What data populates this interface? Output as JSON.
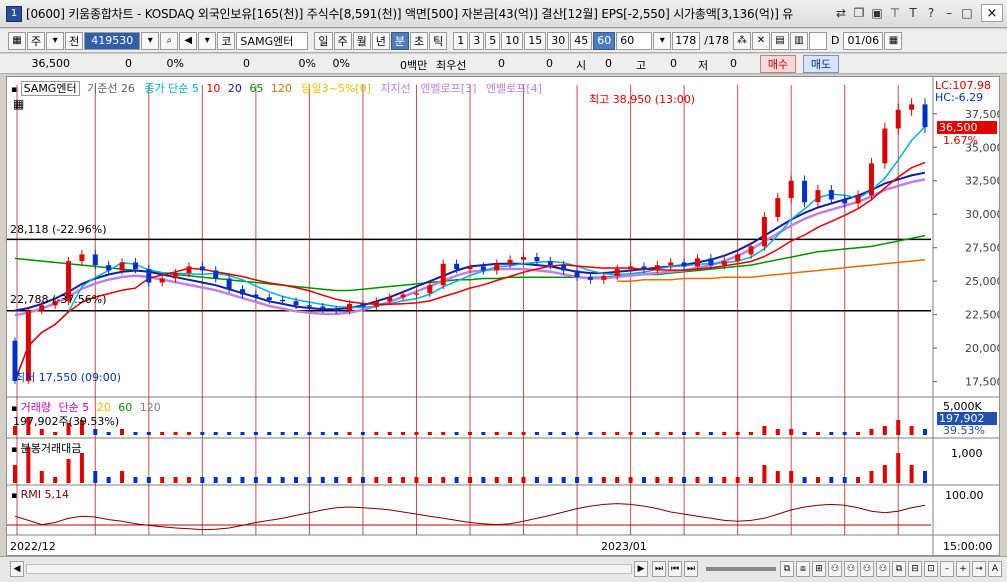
{
  "window": {
    "number": "1",
    "title": "[0600] 키움종합차트 - KOSDAQ 외국인보유[165(천)] 주식수[8,591(천)] 액면[500] 자본금[43(억)] 결산[12월] EPS[-2,550] 시가총액[3,136(억)] 유",
    "icons": [
      "link-icon",
      "copy-icon",
      "restore-icon",
      "pin-icon",
      "font-icon",
      "help-icon",
      "minimize-icon",
      "maximize-icon"
    ],
    "close_label": "×"
  },
  "toolbar": {
    "code_btn": "주",
    "prev_btn": "전",
    "code_value": "419530",
    "market_btn": "코",
    "stock_name": "SAMG엔터",
    "periods": [
      "일",
      "주",
      "월",
      "년",
      "분",
      "초",
      "틱"
    ],
    "active_period": "분",
    "intervals": [
      "1",
      "3",
      "5",
      "10",
      "15",
      "30",
      "45",
      "60"
    ],
    "active_interval": "60",
    "interval_select": "60",
    "count_value": "178",
    "count_total": "/178",
    "checkbox_label": "D",
    "date_value": "01/06"
  },
  "infobar": {
    "price": "36,500",
    "change": "0",
    "change_pct": "0%",
    "volume": "0",
    "volume_pct": "0%",
    "amount_unit": "0백만",
    "pref_label": "최우선",
    "pref_value": "0",
    "label_open": "시",
    "open_value": "0",
    "label_high": "고",
    "high_value": "0",
    "label_low": "저",
    "low_value": "0",
    "buy_label": "매수",
    "sell_label": "매도"
  },
  "price_legend": {
    "stock": "SAMG엔터",
    "base": "기준선 26",
    "close_label": "종가 단순",
    "ma": [
      "5",
      "10",
      "20",
      "65",
      "120"
    ],
    "band": "당일3~5%[0]",
    "support": "지지선",
    "env3": "엔벨로프[3]",
    "env4": "엔벨로프[4]"
  },
  "annotations": {
    "high": "최고 38,950 (13:00)",
    "low": "최저 17,550 (09:00)",
    "line1": "28,118 (-22.96%)",
    "line2": "22,788 (-37.56%)",
    "lc": "LC:107.98",
    "hc": "HC:-6.29",
    "current_price": "36,500",
    "current_pct": "1.67%"
  },
  "price_axis": [
    "37,500",
    "35,000",
    "32,500",
    "30,000",
    "27,500",
    "25,000",
    "22,500",
    "20,000",
    "17,500"
  ],
  "volume_panel": {
    "title": "거래량",
    "ma_label": "단순",
    "ma": [
      "5",
      "20",
      "60",
      "120"
    ],
    "value": "197,902주(39.53%)",
    "axis_top": "5,000K",
    "badge": "197,902",
    "badge_pct": "39.53%"
  },
  "amount_panel": {
    "title": "분봉거래대금",
    "axis": "1,000"
  },
  "rmi_panel": {
    "title": "RMI 5,14",
    "axis": "100.00"
  },
  "xaxis": {
    "left": "2022/12",
    "mid": "2023/01",
    "right": "15:00:00"
  },
  "colors": {
    "up": "#e00000",
    "down": "#0030c8",
    "ma5": "#00b0e0",
    "ma10": "#e00000",
    "ma20": "#1020a0",
    "ma65": "#009000",
    "ma120": "#e07000",
    "base": "#f0c000",
    "env": "#c080e0"
  },
  "chart_data": {
    "type": "line",
    "ylim": [
      16500,
      39500
    ],
    "candles_close": [
      17550,
      22800,
      23200,
      23500,
      26500,
      27000,
      26200,
      25800,
      26400,
      25900,
      24900,
      25200,
      25600,
      26100,
      25800,
      25200,
      24400,
      24000,
      23800,
      23600,
      23500,
      23200,
      23100,
      22900,
      22800,
      23300,
      23100,
      23500,
      23800,
      24000,
      24100,
      24700,
      26300,
      25900,
      26100,
      25800,
      26300,
      26600,
      26800,
      26500,
      26200,
      25800,
      25300,
      25100,
      25400,
      25900,
      26100,
      25900,
      26200,
      26400,
      26100,
      26700,
      26200,
      26500,
      27000,
      27600,
      29800,
      31200,
      32500,
      30900,
      31800,
      31100,
      30800,
      31400,
      33800,
      36400,
      37800,
      38200,
      36500
    ],
    "ma20": [
      22800,
      23000,
      23300,
      23700,
      24200,
      24800,
      25200,
      25500,
      25700,
      25800,
      25700,
      25500,
      25300,
      25100,
      24900,
      24700,
      24400,
      24100,
      23800,
      23500,
      23300,
      23100,
      23000,
      22900,
      22900,
      23000,
      23200,
      23500,
      23800,
      24200,
      24600,
      25000,
      25400,
      25800,
      26100,
      26200,
      26300,
      26300,
      26300,
      26200,
      26100,
      25900,
      25700,
      25600,
      25600,
      25700,
      25800,
      25900,
      26000,
      26100,
      26200,
      26400,
      26600,
      26900,
      27300,
      27800,
      28400,
      29000,
      29600,
      30100,
      30500,
      30800,
      31100,
      31400,
      31800,
      32300,
      32600,
      32900,
      33100
    ],
    "ma65": [
      26700,
      26600,
      26500,
      26400,
      26300,
      26200,
      26100,
      26000,
      25900,
      25800,
      25700,
      25600,
      25500,
      25400,
      25300,
      25200,
      25100,
      25000,
      24900,
      24800,
      24700,
      24600,
      24500,
      24400,
      24300,
      24300,
      24400,
      24500,
      24600,
      24700,
      24800,
      24900,
      25000,
      25100,
      25100,
      25200,
      25200,
      25300,
      25300,
      25300,
      25300,
      25300,
      25300,
      25300,
      25300,
      25400,
      25400,
      25500,
      25500,
      25600,
      25700,
      25800,
      25900,
      26000,
      26100,
      26200,
      26400,
      26600,
      26800,
      27000,
      27200,
      27300,
      27400,
      27500,
      27600,
      27800,
      28000,
      28200,
      28400
    ],
    "ma120": [
      null,
      null,
      null,
      null,
      null,
      null,
      null,
      null,
      null,
      null,
      null,
      null,
      null,
      null,
      null,
      null,
      null,
      null,
      null,
      null,
      null,
      null,
      null,
      null,
      null,
      null,
      null,
      null,
      null,
      null,
      null,
      null,
      null,
      null,
      null,
      null,
      null,
      null,
      null,
      null,
      null,
      null,
      null,
      null,
      null,
      25000,
      25000,
      25100,
      25100,
      25100,
      25200,
      25200,
      25200,
      25300,
      25300,
      25300,
      25400,
      25500,
      25600,
      25700,
      25800,
      25900,
      26000,
      26100,
      26200,
      26300,
      26400,
      26500,
      26600
    ],
    "volume": [
      3,
      6,
      2,
      1,
      4,
      5,
      2,
      1,
      2,
      1,
      1,
      1,
      1,
      1,
      1,
      1,
      1,
      1,
      1,
      1,
      1,
      1,
      1,
      1,
      1,
      1,
      1,
      1,
      1,
      1,
      1,
      1,
      1,
      1,
      1,
      1,
      1,
      1,
      1,
      1,
      1,
      1,
      1,
      1,
      1,
      1,
      1,
      1,
      1,
      1,
      1,
      1,
      1,
      1,
      1,
      1,
      3,
      2,
      2,
      1,
      1,
      1,
      1,
      1,
      2,
      3,
      5,
      3,
      2
    ],
    "rmi": [
      40,
      30,
      20,
      25,
      35,
      40,
      38,
      32,
      28,
      22,
      18,
      15,
      12,
      10,
      8,
      9,
      12,
      18,
      25,
      30,
      35,
      42,
      48,
      55,
      60,
      62,
      60,
      58,
      55,
      50,
      45,
      40,
      35,
      30,
      25,
      22,
      20,
      22,
      28,
      35,
      42,
      50,
      58,
      64,
      68,
      70,
      68,
      64,
      58,
      50,
      45,
      40,
      35,
      30,
      28,
      30,
      35,
      45,
      55,
      62,
      66,
      68,
      66,
      60,
      52,
      48,
      52,
      60,
      66
    ]
  }
}
